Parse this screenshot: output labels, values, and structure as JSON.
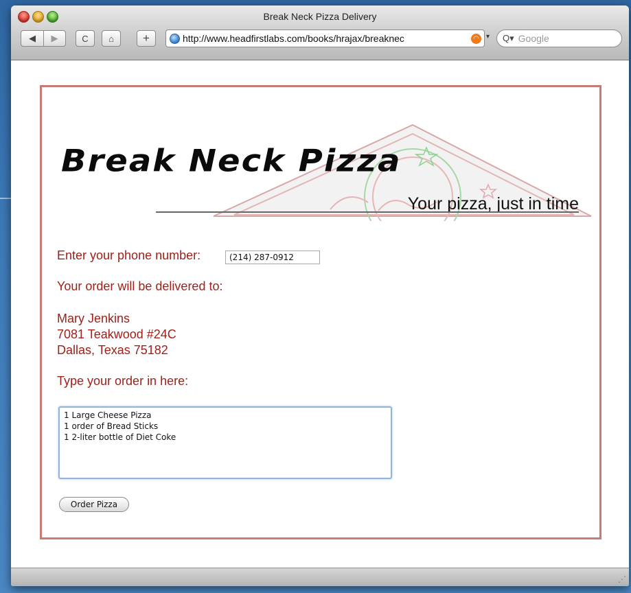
{
  "window": {
    "title": "Break Neck Pizza Delivery"
  },
  "toolbar": {
    "back_icon": "◀",
    "forward_icon": "▶",
    "reload_icon": "C",
    "home_icon": "⌂",
    "add_icon": "+",
    "url": "http://www.headfirstlabs.com/books/hrajax/breaknec",
    "search_placeholder": "Google"
  },
  "page": {
    "logo_text": "Break Neck Pizza",
    "tagline": "Your pizza, just in time",
    "phone_label": "Enter your phone number:",
    "phone_value": "(214) 287-0912",
    "deliver_label": "Your order will be delivered to:",
    "address": {
      "name": "Mary Jenkins",
      "street": "7081 Teakwood #24C",
      "city": "Dallas, Texas 75182"
    },
    "order_label": "Type your order in here:",
    "order_text": "1 Large Cheese Pizza\n1 order of Bread Sticks\n1 2-liter bottle of Diet Coke",
    "order_button": "Order Pizza"
  },
  "colors": {
    "accent_red": "#a0201a",
    "frame_border": "#c77a76",
    "textarea_focus": "#8fb5dc"
  }
}
